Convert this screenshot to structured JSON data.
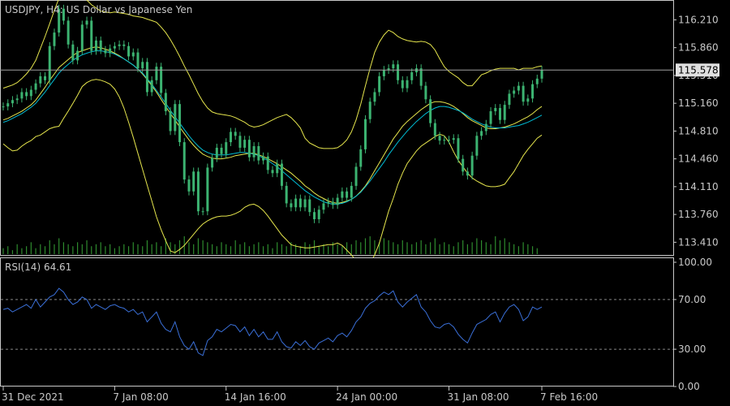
{
  "chart_data": {
    "type": "line",
    "symbol": "USDJPY",
    "timeframe": "H4",
    "description": "US Dollar vs Japanese Yen",
    "title": "USDJPY, H4:  US Dollar vs Japanese Yen",
    "current_price": "115.578",
    "price_ticks": [
      "116.210",
      "115.860",
      "115.510",
      "115.160",
      "114.810",
      "114.460",
      "114.110",
      "113.760",
      "113.410"
    ],
    "price_ylim": [
      113.25,
      116.46
    ],
    "x_labels": [
      "31 Dec 2021",
      "7 Jan 08:00",
      "14 Jan 16:00",
      "24 Jan 00:00",
      "31 Jan 08:00",
      "7 Feb 16:00"
    ],
    "price_series": [
      {
        "name": "close",
        "values": [
          115.12,
          115.16,
          115.2,
          115.22,
          115.3,
          115.25,
          115.33,
          115.41,
          115.5,
          115.45,
          115.88,
          116.05,
          116.35,
          116.2,
          115.9,
          115.7,
          115.82,
          116.15,
          116.2,
          115.82,
          115.95,
          115.83,
          115.79,
          115.85,
          115.88,
          115.9,
          115.88,
          115.75,
          115.8,
          115.6,
          115.68,
          115.3,
          115.45,
          115.62,
          115.29,
          115.06,
          114.81,
          115.15,
          114.67,
          114.2,
          114.05,
          114.3,
          113.8,
          113.8,
          114.35,
          114.47,
          114.6,
          114.52,
          114.67,
          114.8,
          114.75,
          114.6,
          114.7,
          114.48,
          114.62,
          114.44,
          114.49,
          114.32,
          114.28,
          114.4,
          114.12,
          113.9,
          113.85,
          113.96,
          113.85,
          113.95,
          113.79,
          113.7,
          113.82,
          113.9,
          113.92,
          113.88,
          113.97,
          114.05,
          113.97,
          114.12,
          114.36,
          114.58,
          114.96,
          115.18,
          115.3,
          115.5,
          115.58,
          115.6,
          115.65,
          115.45,
          115.35,
          115.45,
          115.55,
          115.6,
          115.38,
          115.21,
          114.91,
          114.75,
          114.69,
          114.7,
          114.7,
          114.72,
          114.46,
          114.3,
          114.25,
          114.5,
          114.75,
          114.81,
          114.9,
          115.06,
          115.1,
          114.95,
          115.14,
          115.28,
          115.32,
          115.38,
          115.18,
          115.22,
          115.4,
          115.47,
          115.58
        ]
      },
      {
        "name": "upper_band",
        "values": [
          115.35,
          115.37,
          115.39,
          115.42,
          115.47,
          115.53,
          115.6,
          115.7,
          115.85,
          116.0,
          116.16,
          116.33,
          116.48,
          116.52,
          116.55,
          116.58,
          116.6,
          116.55,
          116.46,
          116.4,
          116.36,
          116.32,
          116.31,
          116.3,
          116.31,
          116.3,
          116.29,
          116.28,
          116.26,
          116.25,
          116.24,
          116.22,
          116.2,
          116.18,
          116.12,
          116.05,
          115.96,
          115.86,
          115.75,
          115.63,
          115.52,
          115.4,
          115.28,
          115.18,
          115.1,
          115.05,
          115.03,
          115.02,
          115.01,
          115.0,
          114.98,
          114.95,
          114.92,
          114.88,
          114.86,
          114.87,
          114.89,
          114.92,
          114.95,
          114.98,
          115.0,
          115.02,
          114.98,
          114.92,
          114.85,
          114.72,
          114.66,
          114.63,
          114.6,
          114.59,
          114.59,
          114.59,
          114.6,
          114.64,
          114.7,
          114.8,
          114.95,
          115.15,
          115.38,
          115.6,
          115.8,
          115.93,
          116.02,
          116.08,
          116.05,
          116.0,
          115.97,
          115.95,
          115.94,
          115.93,
          115.94,
          115.93,
          115.9,
          115.83,
          115.72,
          115.62,
          115.56,
          115.52,
          115.48,
          115.42,
          115.38,
          115.38,
          115.45,
          115.52,
          115.54,
          115.57,
          115.59,
          115.6,
          115.6,
          115.6,
          115.6,
          115.58,
          115.6,
          115.6,
          115.6,
          115.62,
          115.63
        ]
      },
      {
        "name": "middle_band",
        "values": [
          114.95,
          114.97,
          115.0,
          115.03,
          115.06,
          115.1,
          115.14,
          115.2,
          115.28,
          115.36,
          115.45,
          115.53,
          115.61,
          115.66,
          115.71,
          115.76,
          115.8,
          115.82,
          115.84,
          115.86,
          115.87,
          115.86,
          115.84,
          115.82,
          115.79,
          115.76,
          115.72,
          115.68,
          115.64,
          115.59,
          115.53,
          115.46,
          115.38,
          115.3,
          115.21,
          115.12,
          115.03,
          114.95,
          114.86,
          114.78,
          114.7,
          114.63,
          114.57,
          114.52,
          114.49,
          114.47,
          114.46,
          114.46,
          114.47,
          114.48,
          114.5,
          114.51,
          114.52,
          114.53,
          114.53,
          114.51,
          114.49,
          114.46,
          114.43,
          114.4,
          114.36,
          114.32,
          114.28,
          114.23,
          114.18,
          114.12,
          114.08,
          114.03,
          113.99,
          113.96,
          113.93,
          113.91,
          113.9,
          113.91,
          113.93,
          113.95,
          113.99,
          114.05,
          114.12,
          114.21,
          114.31,
          114.41,
          114.51,
          114.61,
          114.71,
          114.79,
          114.87,
          114.93,
          114.98,
          115.03,
          115.08,
          115.12,
          115.16,
          115.18,
          115.18,
          115.17,
          115.15,
          115.12,
          115.08,
          115.03,
          114.98,
          114.94,
          114.91,
          114.88,
          114.85,
          114.84,
          114.84,
          114.85,
          114.86,
          114.88,
          114.9,
          114.93,
          114.96,
          114.99,
          115.03,
          115.08,
          115.12
        ]
      },
      {
        "name": "lower_band",
        "values": [
          114.65,
          114.6,
          114.56,
          114.57,
          114.62,
          114.66,
          114.69,
          114.74,
          114.76,
          114.8,
          114.84,
          114.86,
          114.87,
          114.97,
          115.06,
          115.16,
          115.26,
          115.37,
          115.42,
          115.45,
          115.46,
          115.45,
          115.43,
          115.4,
          115.34,
          115.24,
          115.1,
          114.92,
          114.73,
          114.53,
          114.33,
          114.13,
          113.93,
          113.73,
          113.57,
          113.43,
          113.3,
          113.28,
          113.32,
          113.37,
          113.44,
          113.51,
          113.58,
          113.64,
          113.68,
          113.71,
          113.73,
          113.74,
          113.74,
          113.75,
          113.77,
          113.8,
          113.85,
          113.88,
          113.89,
          113.86,
          113.81,
          113.74,
          113.66,
          113.58,
          113.5,
          113.44,
          113.38,
          113.36,
          113.35,
          113.34,
          113.34,
          113.35,
          113.36,
          113.37,
          113.38,
          113.38,
          113.4,
          113.37,
          113.31,
          113.25,
          113.18,
          113.13,
          113.12,
          113.15,
          113.25,
          113.4,
          113.6,
          113.8,
          113.96,
          114.14,
          114.28,
          114.4,
          114.48,
          114.56,
          114.62,
          114.66,
          114.7,
          114.74,
          114.77,
          114.75,
          114.67,
          114.55,
          114.44,
          114.36,
          114.28,
          114.22,
          114.18,
          114.15,
          114.12,
          114.11,
          114.11,
          114.12,
          114.14,
          114.22,
          114.3,
          114.4,
          114.5,
          114.58,
          114.65,
          114.72,
          114.76
        ]
      },
      {
        "name": "moving_average",
        "values": [
          114.92,
          114.94,
          114.97,
          115.0,
          115.03,
          115.07,
          115.11,
          115.16,
          115.23,
          115.3,
          115.38,
          115.46,
          115.54,
          115.6,
          115.65,
          115.7,
          115.74,
          115.77,
          115.79,
          115.81,
          115.82,
          115.82,
          115.81,
          115.8,
          115.78,
          115.75,
          115.72,
          115.68,
          115.64,
          115.59,
          115.54,
          115.47,
          115.4,
          115.32,
          115.24,
          115.16,
          115.07,
          114.99,
          114.91,
          114.83,
          114.75,
          114.68,
          114.62,
          114.57,
          114.54,
          114.52,
          114.51,
          114.51,
          114.51,
          114.52,
          114.53,
          114.54,
          114.54,
          114.53,
          114.52,
          114.5,
          114.47,
          114.44,
          114.4,
          114.36,
          114.31,
          114.26,
          114.21,
          114.16,
          114.11,
          114.06,
          114.02,
          113.98,
          113.95,
          113.92,
          113.9,
          113.89,
          113.89,
          113.9,
          113.92,
          113.95,
          113.99,
          114.04,
          114.11,
          114.18,
          114.26,
          114.34,
          114.42,
          114.51,
          114.59,
          114.67,
          114.74,
          114.81,
          114.87,
          114.93,
          114.98,
          115.03,
          115.07,
          115.1,
          115.12,
          115.12,
          115.11,
          115.09,
          115.07,
          115.04,
          115.0,
          114.96,
          114.93,
          114.9,
          114.88,
          114.86,
          114.85,
          114.85,
          114.85,
          114.86,
          114.87,
          114.88,
          114.9,
          114.92,
          114.95,
          114.98,
          115.01
        ]
      }
    ],
    "volume": [
      3,
      4,
      2,
      5,
      3,
      4,
      6,
      3,
      5,
      4,
      7,
      5,
      8,
      6,
      5,
      4,
      6,
      5,
      7,
      4,
      5,
      6,
      4,
      5,
      3,
      4,
      5,
      4,
      6,
      5,
      4,
      7,
      5,
      6,
      4,
      8,
      6,
      5,
      7,
      9,
      6,
      5,
      8,
      7,
      6,
      5,
      4,
      6,
      5,
      4,
      7,
      5,
      6,
      4,
      5,
      6,
      4,
      5,
      3,
      6,
      5,
      4,
      6,
      5,
      4,
      6,
      5,
      7,
      4,
      5,
      4,
      6,
      5,
      4,
      6,
      5,
      7,
      6,
      8,
      9,
      7,
      6,
      8,
      7,
      6,
      5,
      7,
      6,
      5,
      6,
      7,
      5,
      6,
      8,
      5,
      6,
      5,
      4,
      6,
      7,
      5,
      6,
      8,
      7,
      6,
      5,
      9,
      7,
      8,
      6,
      5,
      4,
      6,
      5,
      4,
      3
    ],
    "indicator": {
      "label": "RSI(14) 64.61",
      "ticks": [
        "100.00",
        "70.00",
        "30.00",
        "0.00"
      ],
      "levels": [
        70,
        30
      ],
      "ylim": [
        0,
        100
      ],
      "values": [
        62,
        63,
        60,
        62,
        64,
        66,
        63,
        70,
        64,
        68,
        72,
        74,
        79,
        76,
        70,
        66,
        68,
        72,
        70,
        63,
        66,
        64,
        62,
        65,
        66,
        64,
        63,
        60,
        62,
        58,
        60,
        52,
        56,
        60,
        51,
        46,
        44,
        52,
        40,
        33,
        30,
        36,
        27,
        25,
        37,
        40,
        46,
        44,
        47,
        50,
        49,
        44,
        48,
        41,
        46,
        40,
        44,
        38,
        38,
        44,
        36,
        32,
        31,
        36,
        33,
        37,
        32,
        30,
        35,
        37,
        39,
        36,
        41,
        43,
        40,
        45,
        52,
        56,
        63,
        67,
        69,
        73,
        76,
        74,
        77,
        68,
        64,
        68,
        71,
        74,
        64,
        60,
        53,
        48,
        47,
        50,
        51,
        48,
        42,
        38,
        35,
        43,
        50,
        52,
        54,
        58,
        60,
        52,
        59,
        64,
        66,
        62,
        53,
        56,
        64,
        62,
        64
      ]
    },
    "colors": {
      "background": "#000000",
      "candles": "#3cb371",
      "upper_band": "#e6e64d",
      "middle_band": "#e6e64d",
      "lower_band": "#e6e64d",
      "moving_average": "#00bcd4",
      "volume": "#2e8b2e",
      "rsi": "#3a6fd8",
      "axis": "#c8c8c8",
      "grid": "#888888"
    }
  }
}
